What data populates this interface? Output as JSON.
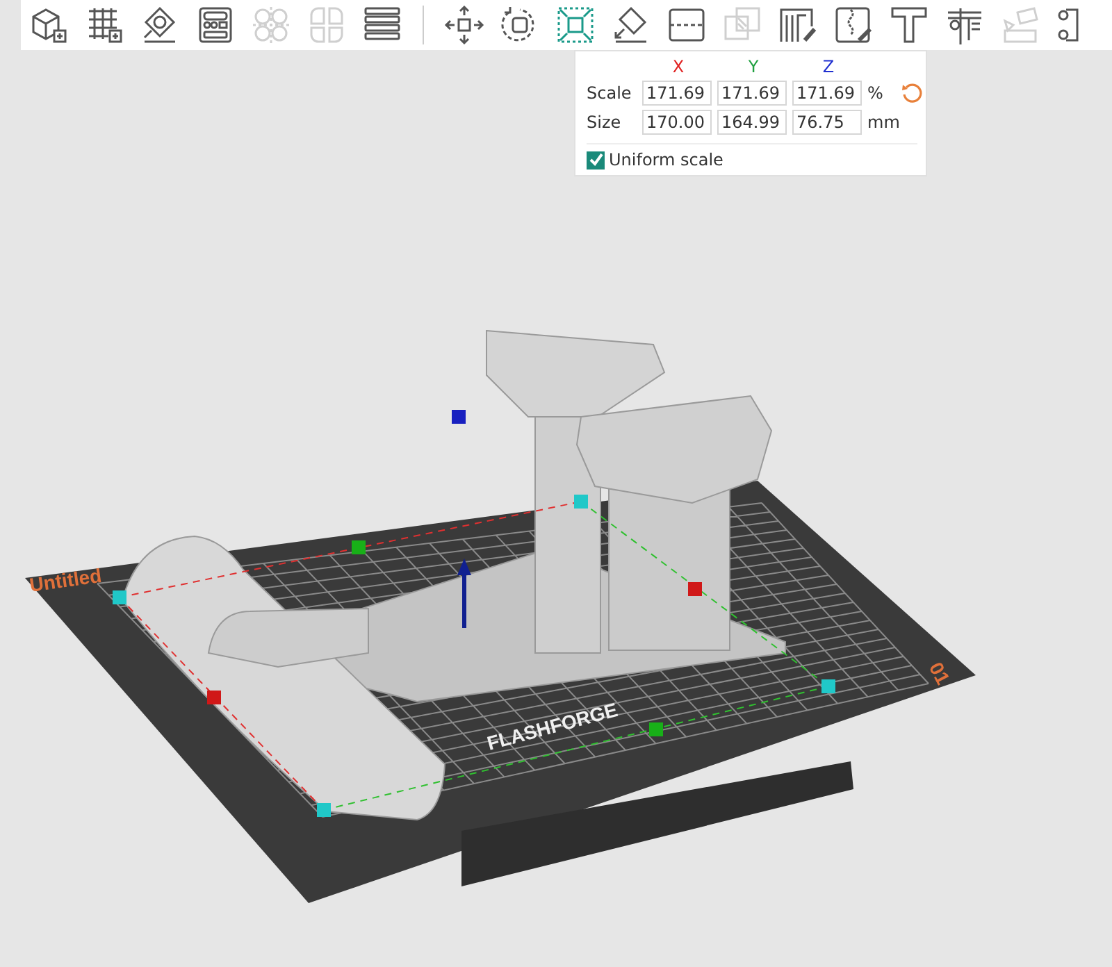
{
  "toolbar": {
    "tools": [
      {
        "selected": false,
        "disabled": false
      },
      {
        "selected": false,
        "disabled": false
      },
      {
        "selected": false,
        "disabled": false
      },
      {
        "selected": false,
        "disabled": false
      },
      {
        "selected": false,
        "disabled": true
      },
      {
        "selected": false,
        "disabled": true
      },
      {
        "selected": false,
        "disabled": false
      },
      {
        "selected": false,
        "disabled": false
      },
      {
        "selected": false,
        "disabled": false
      },
      {
        "selected": true,
        "disabled": false
      },
      {
        "selected": false,
        "disabled": false
      },
      {
        "selected": false,
        "disabled": false
      },
      {
        "selected": false,
        "disabled": true
      },
      {
        "selected": false,
        "disabled": false
      },
      {
        "selected": false,
        "disabled": false
      },
      {
        "selected": false,
        "disabled": false
      },
      {
        "selected": false,
        "disabled": false
      },
      {
        "selected": false,
        "disabled": true
      },
      {
        "selected": false,
        "disabled": false
      }
    ]
  },
  "scale_panel": {
    "axes": [
      {
        "label": "X",
        "color": "#e02020"
      },
      {
        "label": "Y",
        "color": "#20a040"
      },
      {
        "label": "Z",
        "color": "#2030d0"
      }
    ],
    "rows": [
      {
        "label": "Scale",
        "values": [
          "171.69",
          "171.69",
          "171.69"
        ],
        "unit": "%",
        "reset": true
      },
      {
        "label": "Size",
        "values": [
          "170.00",
          "164.99",
          "76.75"
        ],
        "unit": "mm"
      }
    ],
    "uniform_scale": {
      "label": "Uniform scale",
      "checked": true
    }
  },
  "viewport": {
    "plate_name": "Untitled",
    "brand": "FLASHFORGE",
    "plate_number": "01"
  }
}
